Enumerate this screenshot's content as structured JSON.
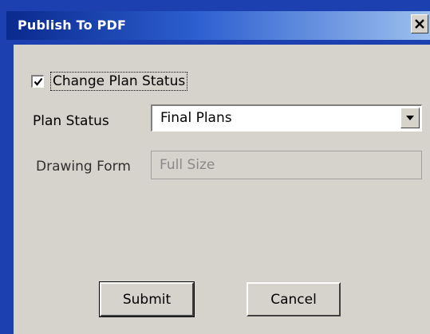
{
  "window": {
    "title": "Publish To PDF",
    "close_icon": "close-icon"
  },
  "form": {
    "change_plan_status": {
      "label": "Change Plan Status",
      "checked": true
    },
    "plan_status": {
      "label": "Plan Status",
      "value": "Final Plans"
    },
    "drawing_form": {
      "label": "Drawing Form",
      "value": "Full Size",
      "disabled": true
    }
  },
  "buttons": {
    "submit_label": "Submit",
    "cancel_label": "Cancel"
  },
  "colors": {
    "desktop": "#1c40b0",
    "titlebar_start": "#0a2a8e",
    "titlebar_end": "#9cc0ee",
    "face": "#d6d2cc"
  }
}
